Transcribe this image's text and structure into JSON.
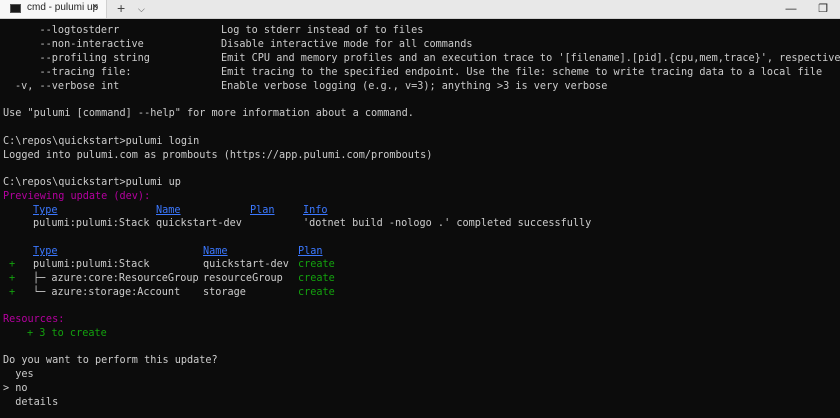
{
  "window": {
    "tab_title": "cmd - pulumi  up",
    "tab_close_glyph": "×",
    "new_tab_glyph": "+",
    "dropdown_glyph": "⌵",
    "minimize_glyph": "—",
    "maximize_glyph": "❐"
  },
  "help": {
    "flags": [
      {
        "flag": "    --logtostderr",
        "desc": "Log to stderr instead of to files"
      },
      {
        "flag": "    --non-interactive",
        "desc": "Disable interactive mode for all commands"
      },
      {
        "flag": "    --profiling string",
        "desc": "Emit CPU and memory profiles and an execution trace to '[filename].[pid].{cpu,mem,trace}', respectively"
      },
      {
        "flag": "    --tracing file:",
        "desc": "Emit tracing to the specified endpoint. Use the file: scheme to write tracing data to a local file"
      },
      {
        "flag": "-v, --verbose int",
        "desc": "Enable verbose logging (e.g., v=3); anything >3 is very verbose"
      }
    ],
    "footer": "Use \"pulumi [command] --help\" for more information about a command."
  },
  "login": {
    "prompt": "C:\\repos\\quickstart>pulumi login",
    "output": "Logged into pulumi.com as prombouts (https://app.pulumi.com/prombouts)"
  },
  "up": {
    "prompt": "C:\\repos\\quickstart>pulumi up",
    "previewing": "Previewing update (dev):",
    "table1": {
      "headers": {
        "type": "Type",
        "name": "Name",
        "plan": "Plan",
        "info": "Info"
      },
      "row": {
        "type": "pulumi:pulumi:Stack",
        "name": "quickstart-dev",
        "info": "'dotnet build -nologo .' completed successfully"
      }
    },
    "table2": {
      "headers": {
        "type": "Type",
        "name": "Name",
        "plan": "Plan"
      },
      "rows": [
        {
          "sign": "+",
          "type": "pulumi:pulumi:Stack",
          "name": "quickstart-dev",
          "plan": "create"
        },
        {
          "sign": "+",
          "type": "├─ azure:core:ResourceGroup",
          "name": "resourceGroup",
          "plan": "create"
        },
        {
          "sign": "+",
          "type": "└─ azure:storage:Account",
          "name": "storage",
          "plan": "create"
        }
      ]
    },
    "resources_label": "Resources:",
    "resources_summary": "+ 3 to create",
    "question": "Do you want to perform this update?",
    "options": [
      "  yes",
      "> no",
      "  details"
    ]
  },
  "colors": {
    "background": "#0c0c0c",
    "text": "#cccccc",
    "header_blue": "#3b78ff",
    "green": "#13a10e",
    "magenta": "#b4009e"
  }
}
